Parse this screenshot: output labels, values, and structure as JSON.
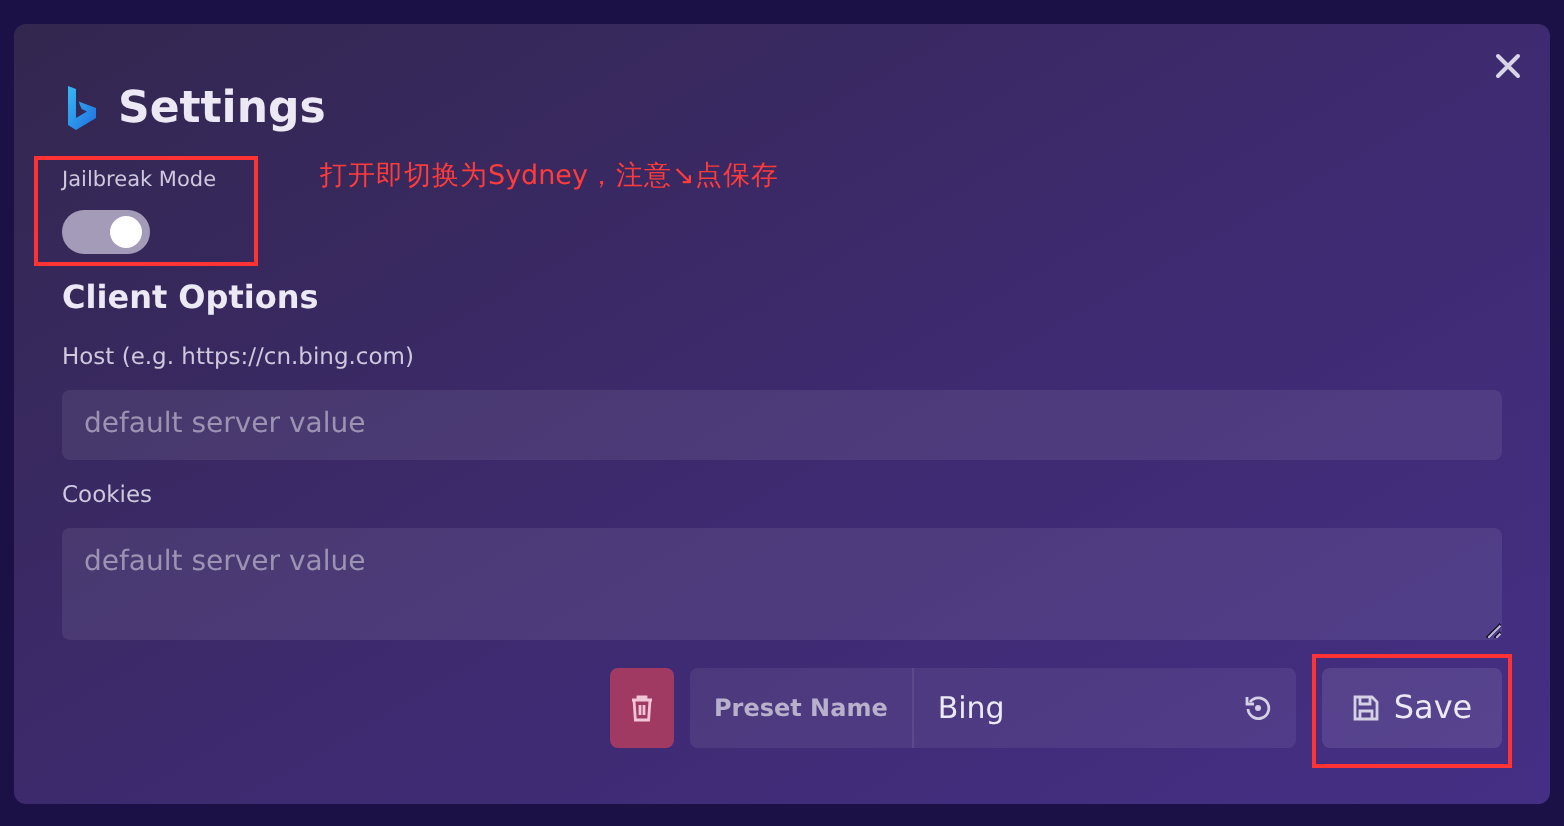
{
  "dialog": {
    "title": "Settings"
  },
  "jailbreak": {
    "label": "Jailbreak Mode",
    "on": true,
    "highlighted": true
  },
  "annotation": "打开即切换为Sydney，注意↘点保存",
  "client_options": {
    "heading": "Client Options",
    "fields": [
      {
        "kind": "input",
        "label": "Host (e.g. https://cn.bing.com)",
        "placeholder": "default server value"
      },
      {
        "kind": "textarea",
        "label": "Cookies",
        "placeholder": "default server value"
      }
    ]
  },
  "preset": {
    "label": "Preset Name",
    "value": "Bing"
  },
  "save_button": {
    "label": "Save",
    "highlighted": true
  }
}
